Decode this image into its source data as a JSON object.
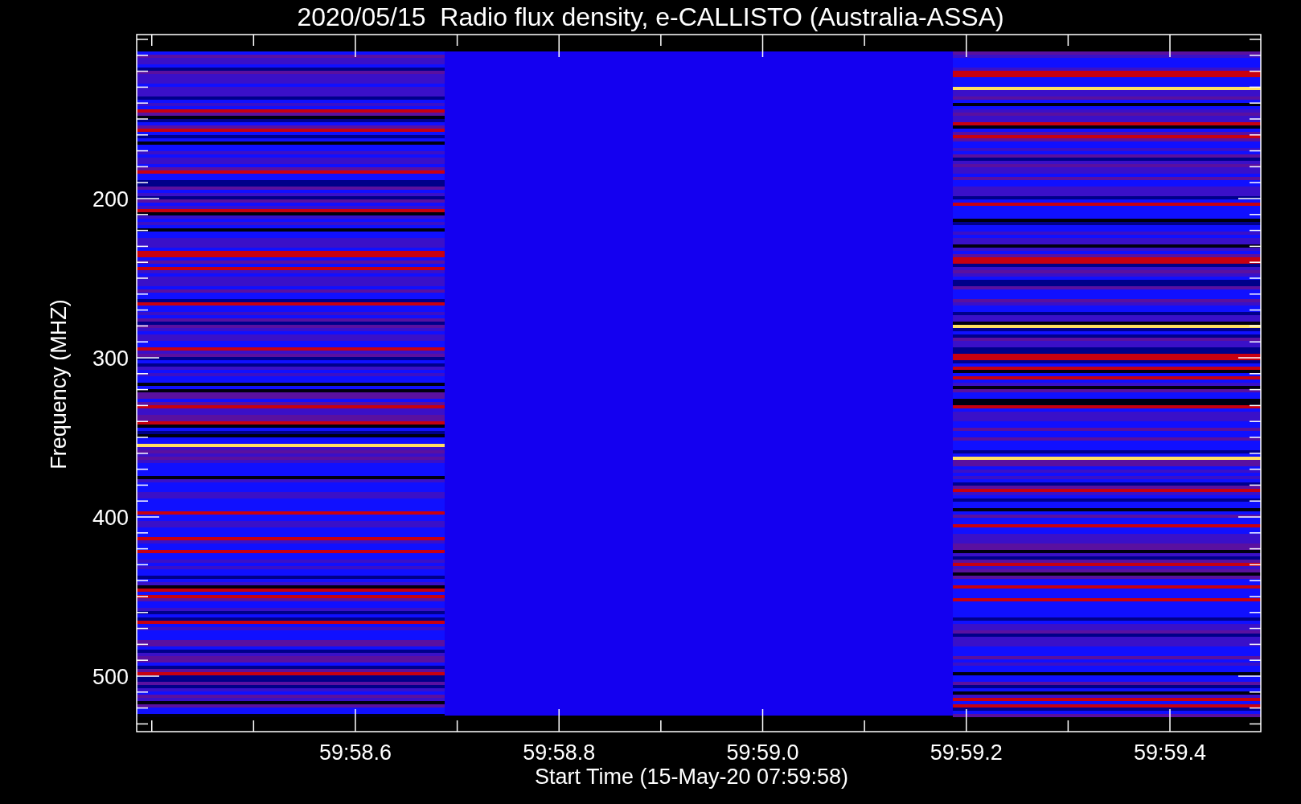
{
  "title": "2020/05/15  Radio flux density, e-CALLISTO (Australia-ASSA)",
  "y_axis": {
    "label": "Frequency (MHZ)",
    "ticks": [
      "200",
      "300",
      "400",
      "500"
    ]
  },
  "x_axis": {
    "label": "Start Time (15-May-20 07:59:58)",
    "ticks": [
      "59:58.6",
      "59:58.8",
      "59:59.0",
      "59:59.2",
      "59:59.4"
    ]
  }
}
